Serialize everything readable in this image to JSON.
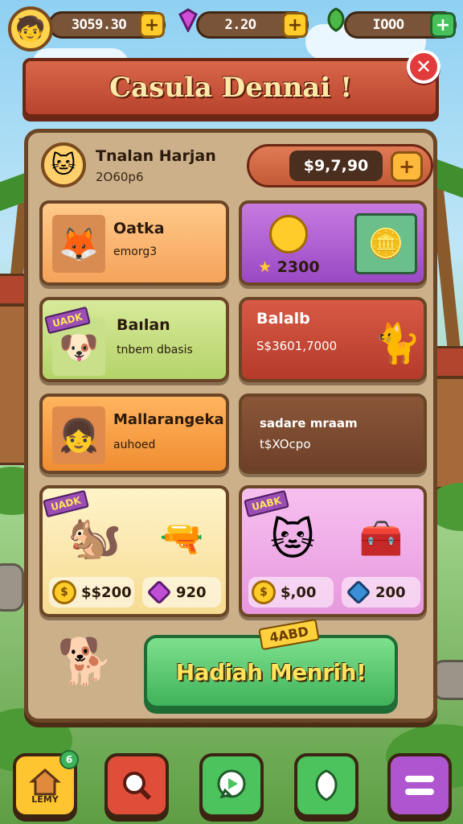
{
  "hud": {
    "coins": "3O59.3O",
    "gems": "2.2O",
    "leaves": "IOOO",
    "plus": "+"
  },
  "banner": {
    "title": "Casula Dennai !",
    "close": "✕"
  },
  "profile": {
    "name": "Tnalan Harjan",
    "subtitle": "2O60p6",
    "balance": "$9,7,90",
    "plus": "+"
  },
  "offers": [
    {
      "title": "Oatka",
      "subtitle": "emorg3",
      "tag": ""
    },
    {
      "title": "",
      "price": "2300",
      "tag": ""
    },
    {
      "title": "Baılan",
      "subtitle": "tnbem dbasis",
      "tag": "UADK"
    },
    {
      "title": "Balalb",
      "subtitle": "S$3601,7000",
      "tag": ""
    },
    {
      "title": "Mallarangeka",
      "subtitle": "auhoed",
      "tag": ""
    },
    {
      "title": "sadare mraam",
      "subtitle": "t$XOcpo",
      "tag": ""
    },
    {
      "title": "",
      "price": "$$200",
      "price2": "920",
      "tag": "UADK"
    },
    {
      "title": "",
      "price": "$,00",
      "price2": "200",
      "tag": "UABK"
    }
  ],
  "claim": {
    "label": "Hadiah Menrih!",
    "tag": "4ABD"
  },
  "nav": [
    {
      "label": "LEMY",
      "badge": "6",
      "icon": "home-icon",
      "color": "#ffc531"
    },
    {
      "label": "",
      "icon": "search-icon",
      "color": "#e04e3a"
    },
    {
      "label": "",
      "icon": "chat-icon",
      "color": "#4cc35c"
    },
    {
      "label": "",
      "icon": "leaf-icon",
      "color": "#4cc35c"
    },
    {
      "label": "",
      "icon": "menu-icon",
      "color": "#b055d0"
    }
  ]
}
